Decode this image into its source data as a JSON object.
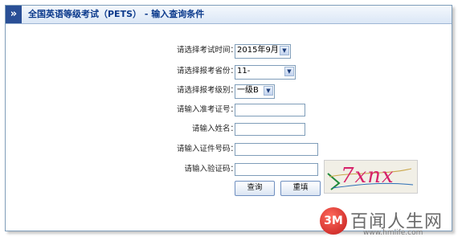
{
  "header": {
    "chevron": "»",
    "title": "全国英语等级考试（PETS）  -  输入查询条件"
  },
  "form": {
    "exam_time": {
      "label": "请选择考试时间：",
      "value": "2015年9月"
    },
    "province": {
      "label": "请选择报考省份：",
      "value": "11-"
    },
    "level": {
      "label": "请选择报考级别：",
      "value": "一级B"
    },
    "admission_no": {
      "label": "请输入准考证号：",
      "value": ""
    },
    "name": {
      "label": "请输入姓名：",
      "value": ""
    },
    "id_no": {
      "label": "请输入证件号码：",
      "value": ""
    },
    "captcha": {
      "label": "请输入验证码：",
      "value": "",
      "image_text": "7xnx"
    }
  },
  "buttons": {
    "query": "查询",
    "reset": "重填"
  },
  "watermark": {
    "logo": "3M",
    "text": "百闻人生网",
    "url": "www.hmlife.com"
  },
  "icons": {
    "chevron": "chevron-right-icon",
    "dropdown": "chevron-down-icon"
  },
  "colors": {
    "title": "#0b3a8c",
    "chevron_bg": "#2a4f96",
    "captcha_text": "#d6226a"
  }
}
